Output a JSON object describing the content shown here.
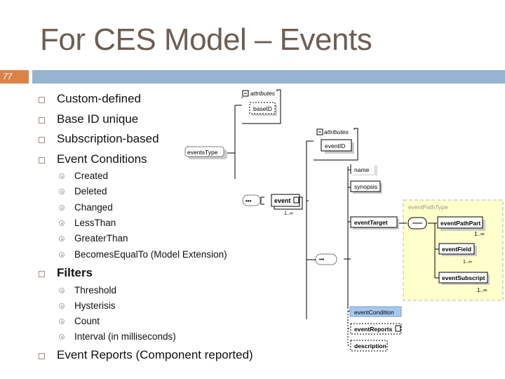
{
  "slide": {
    "title": "For CES Model – Events",
    "number": "77",
    "colors": {
      "title": "#6d5e55",
      "number_box": "#dd8147",
      "header_bar": "#96b3cf",
      "path_type_bg": "#ffffcc",
      "condition_fill": "#a8c8ee"
    }
  },
  "bullets": [
    {
      "text": "Custom-defined"
    },
    {
      "text": "Base ID unique"
    },
    {
      "text": "Subscription-based"
    },
    {
      "text": "Event Conditions",
      "children": [
        "Created",
        "Deleted",
        "Changed",
        "LessThan",
        "GreaterThan",
        "BecomesEqualTo (Model Extension)"
      ]
    },
    {
      "text": "Filters",
      "children": [
        "Threshold",
        "Hysterisis",
        "Count",
        "Interval (in milliseconds)"
      ]
    },
    {
      "text": "Event Reports (Component reported)"
    }
  ],
  "diagram": {
    "events_type": "eventsType",
    "attributes_label": "attributes",
    "base_id": "baseID",
    "event": "event",
    "event_card": "1..∞",
    "event_attributes_label": "attributes",
    "event_id": "eventID",
    "name": "name",
    "synopsis": "synopsis",
    "event_target": "eventTarget",
    "path_type": "eventPathType",
    "event_path_part": "eventPathPart",
    "event_path_part_card": "1..∞",
    "event_field": "eventField",
    "event_field_card": "1..∞",
    "event_subscript": "eventSubscript",
    "event_subscript_card": "1..∞",
    "event_condition": "eventCondition",
    "event_reports": "eventReports",
    "description": "description",
    "sequence_glyph": "•••"
  }
}
